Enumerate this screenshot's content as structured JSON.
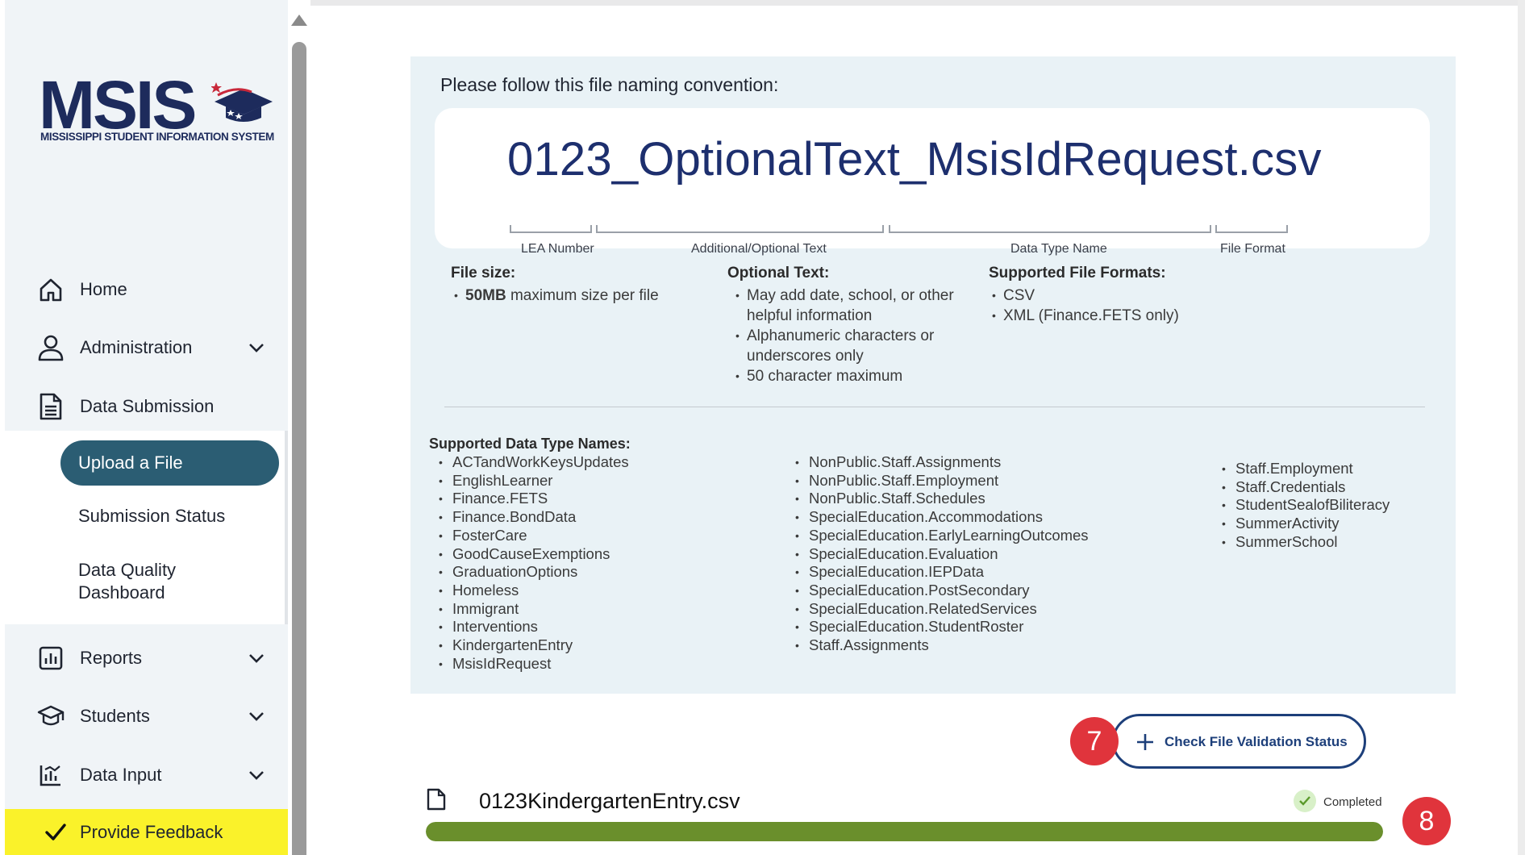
{
  "logo": {
    "text": "MSIS",
    "subtitle": "MISSISSIPPI STUDENT INFORMATION SYSTEM"
  },
  "sidebar": {
    "items": [
      {
        "label": "Home",
        "icon": "home-icon",
        "expandable": false
      },
      {
        "label": "Administration",
        "icon": "user-icon",
        "expandable": true
      },
      {
        "label": "Data Submission",
        "icon": "document-icon",
        "expandable": false
      },
      {
        "label": "Reports",
        "icon": "bar-chart-icon",
        "expandable": true
      },
      {
        "label": "Students",
        "icon": "graduation-cap-icon",
        "expandable": true
      },
      {
        "label": "Data Input",
        "icon": "chart-input-icon",
        "expandable": true
      }
    ],
    "submenu": {
      "active": "Upload a File",
      "status": "Submission Status",
      "dq_line1": "Data Quality",
      "dq_line2": "Dashboard"
    },
    "feedback": "Provide Feedback"
  },
  "convention": {
    "title": "Please follow this file naming convention:",
    "filename": "0123_OptionalText_MsisIdRequest.csv",
    "labels": {
      "lea": "LEA Number",
      "optional": "Additional/Optional Text",
      "datatype": "Data Type Name",
      "format": "File Format"
    }
  },
  "info": {
    "filesize": {
      "title": "File size:",
      "bold": "50MB",
      "rest": " maximum size per file"
    },
    "optional": {
      "title": "Optional Text:",
      "items": [
        "May add date, school, or other",
        "helpful information",
        "Alphanumeric characters or",
        "underscores only",
        "50 character maximum"
      ]
    },
    "formats": {
      "title": "Supported File Formats:",
      "items": [
        "CSV",
        "XML (Finance.FETS only)"
      ]
    }
  },
  "data_types": {
    "title": "Supported Data Type Names:",
    "col1": [
      "ACTandWorkKeysUpdates",
      "EnglishLearner",
      "Finance.FETS",
      "Finance.BondData",
      "FosterCare",
      "GoodCauseExemptions",
      "GraduationOptions",
      "Homeless",
      "Immigrant",
      "Interventions",
      "KindergartenEntry",
      "MsisIdRequest"
    ],
    "col2": [
      "NonPublic.Staff.Assignments",
      "NonPublic.Staff.Employment",
      "NonPublic.Staff.Schedules",
      "SpecialEducation.Accommodations",
      "SpecialEducation.EarlyLearningOutcomes",
      "SpecialEducation.Evaluation",
      "SpecialEducation.IEPData",
      "SpecialEducation.PostSecondary",
      "SpecialEducation.RelatedServices",
      "SpecialEducation.StudentRoster",
      "Staff.Assignments"
    ],
    "col3": [
      "Staff.Employment",
      "Staff.Credentials",
      "StudentSealofBiliteracy",
      "SummerActivity",
      "SummerSchool"
    ]
  },
  "actions": {
    "check_status": "Check File Validation Status"
  },
  "badges": {
    "step7": "7",
    "step8": "8"
  },
  "upload": {
    "file_name": "0123KindergartenEntry.csv",
    "status": "Completed",
    "progress": 1.0
  },
  "colors": {
    "brand_navy": "#1d2b5c",
    "active_teal": "#2b5d73",
    "panel_bg": "#e9f2f6",
    "progress_green": "#6a8f2c",
    "feedback_yellow": "#faf22a",
    "badge_red": "#e0343c"
  }
}
